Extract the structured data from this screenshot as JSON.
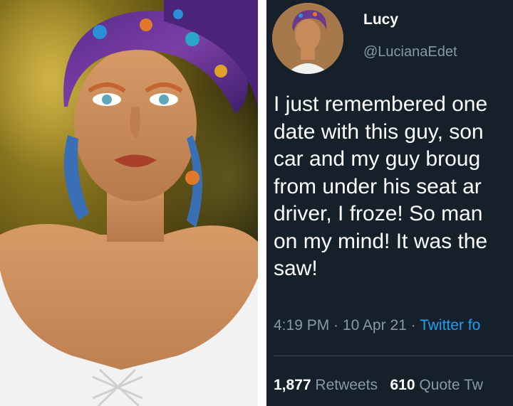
{
  "tweet": {
    "display_name": "Lucy",
    "handle": "@LucianaEdet",
    "text_lines": [
      "I just remembered one",
      "date with this guy, son",
      "car and my guy broug",
      "from under his seat ar",
      "driver, I froze! So man",
      "on my mind! It was the",
      "saw!"
    ],
    "time": "4:19 PM",
    "dot1": " · ",
    "date": "10 Apr 21",
    "dot2": " · ",
    "source": "Twitter fo",
    "retweets_count": "1,877",
    "retweets_label": "Retweets",
    "quotes_count": "610",
    "quotes_label": "Quote Tw"
  },
  "colors": {
    "background": "#15202b",
    "primary_text": "#ffffff",
    "secondary_text": "#8899a6",
    "link": "#1da1f2",
    "divider": "#38444d"
  },
  "icons": {
    "avatar": "profile-photo",
    "photo": "woman-portrait-headwrap"
  }
}
